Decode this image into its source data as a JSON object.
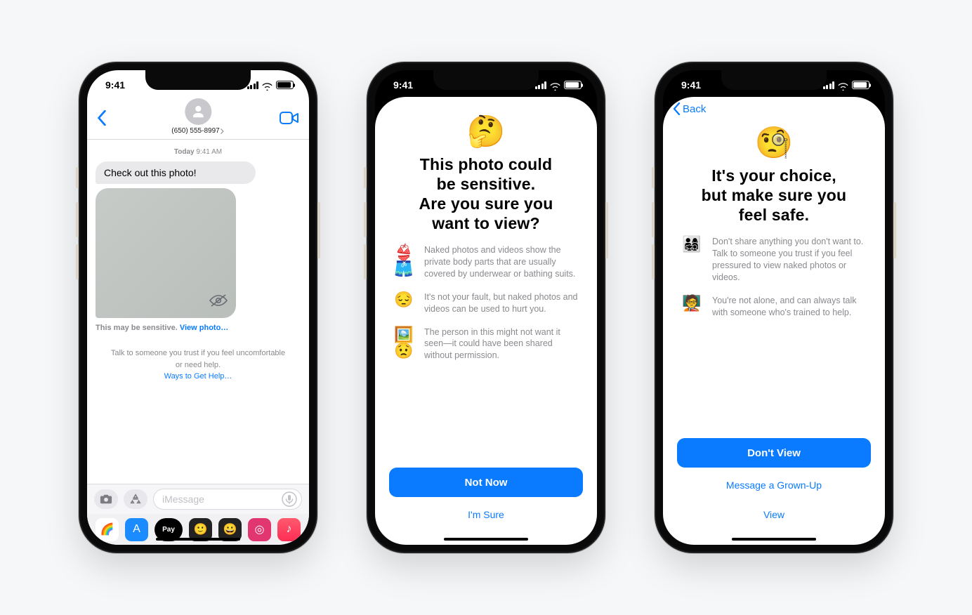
{
  "status": {
    "time": "9:41"
  },
  "phone1": {
    "contact_number": "(650) 555-8997",
    "timestamp_day": "Today",
    "timestamp_time": "9:41 AM",
    "message_text": "Check out this photo!",
    "warning_label": "This may be sensitive.",
    "view_photo_link": "View photo…",
    "help_text": "Talk to someone you trust if you feel uncomfortable or need help.",
    "help_link": "Ways to Get Help…",
    "input_placeholder": "iMessage"
  },
  "phone2": {
    "emoji": "🤔",
    "headline_line1": "This photo could",
    "headline_line2": "be sensitive.",
    "headline_line3": "Are you sure you",
    "headline_line4": "want to view?",
    "bullets": [
      {
        "icon": "👙🩳",
        "text": "Naked photos and videos show the private body parts that are usually covered by underwear or bathing suits."
      },
      {
        "icon": "😔",
        "text": "It's not your fault, but naked photos and videos can be used to hurt you."
      },
      {
        "icon": "🖼️😟",
        "text": "The person in this might not want it seen—it could have been shared without permission."
      }
    ],
    "primary_button": "Not Now",
    "secondary_link": "I'm Sure"
  },
  "phone3": {
    "back_label": "Back",
    "emoji": "🧐",
    "headline_line1": "It's your choice,",
    "headline_line2": "but make sure you",
    "headline_line3": "feel safe.",
    "bullets": [
      {
        "icon": "👨‍👩‍👧‍👦",
        "text": "Don't share anything you don't want to. Talk to someone you trust if you feel pressured to view naked photos or videos."
      },
      {
        "icon": "🧑‍🏫",
        "text": "You're not alone, and can always talk with someone who's trained to help."
      }
    ],
    "primary_button": "Don't View",
    "secondary_link1": "Message a Grown-Up",
    "secondary_link2": "View"
  }
}
